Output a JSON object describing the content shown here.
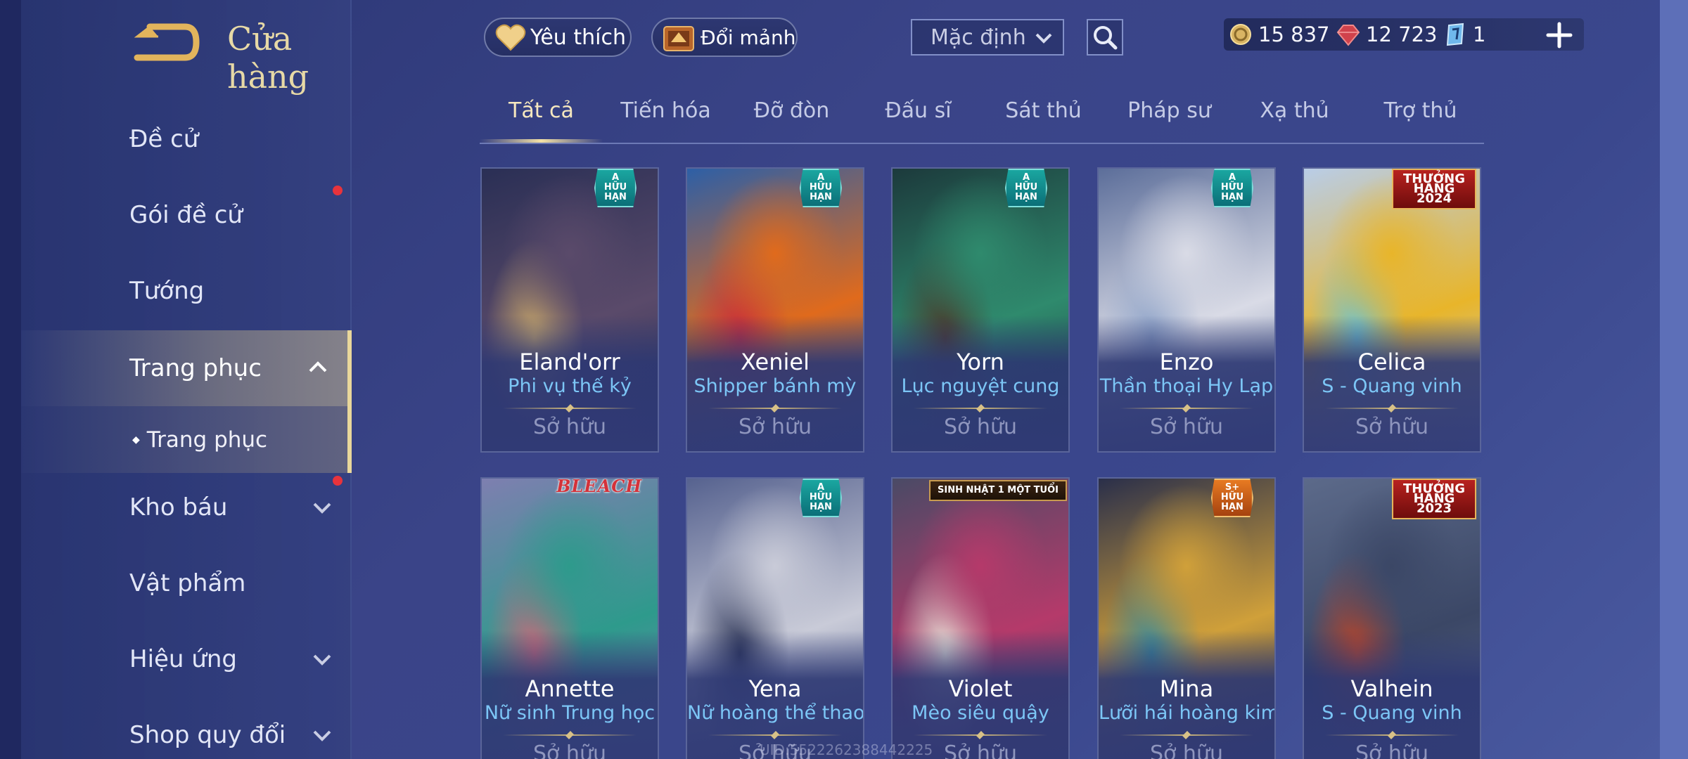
{
  "sidebar": {
    "title": "Cửa hàng",
    "items": [
      {
        "label": "Đề cử",
        "chevron": false,
        "red_dot": false
      },
      {
        "label": "Gói đề cử",
        "chevron": false,
        "red_dot": true
      },
      {
        "label": "Tướng",
        "chevron": false,
        "red_dot": false
      },
      {
        "label": "Trang phục",
        "chevron": "up",
        "red_dot": false,
        "active": true
      },
      {
        "label": "Kho báu",
        "chevron": "down",
        "red_dot": true
      },
      {
        "label": "Vật phẩm",
        "chevron": false,
        "red_dot": false
      },
      {
        "label": "Hiệu ứng",
        "chevron": "down",
        "red_dot": false
      },
      {
        "label": "Shop quy đổi",
        "chevron": "down",
        "red_dot": false
      }
    ],
    "sub_item": "Trang phục"
  },
  "topbar": {
    "favorite_label": "Yêu thích",
    "exchange_label": "Đổi mảnh",
    "sort_value": "Mặc định",
    "currencies": [
      {
        "icon": "gold-coin-icon",
        "value": "15 837"
      },
      {
        "icon": "ruby-gem-icon",
        "value": "12 723"
      },
      {
        "icon": "ticket-icon",
        "value": "1"
      }
    ]
  },
  "tabs": [
    "Tất cả",
    "Tiến hóa",
    "Đỡ đòn",
    "Đấu sĩ",
    "Sát thủ",
    "Pháp sư",
    "Xạ thủ",
    "Trợ thủ"
  ],
  "active_tab": 0,
  "cards": [
    {
      "hero": "Eland'orr",
      "skin": "Phi vụ thế kỷ",
      "status": "Sở hữu",
      "badge": "A HỮU HẠN",
      "badge_style": "teal",
      "colors": [
        "#2a2f55",
        "#5a4a6a",
        "#c7a66a"
      ]
    },
    {
      "hero": "Xeniel",
      "skin": "Shipper bánh mỳ",
      "status": "Sở hữu",
      "badge": "A HỮU HẠN",
      "badge_style": "teal",
      "colors": [
        "#2d5fa6",
        "#e06a1c",
        "#c92c3a"
      ]
    },
    {
      "hero": "Yorn",
      "skin": "Lục nguyệt cung",
      "status": "Sở hữu",
      "badge": "A HỮU HẠN",
      "badge_style": "teal",
      "colors": [
        "#1c3a3c",
        "#2f8a6d",
        "#4b3a2a"
      ]
    },
    {
      "hero": "Enzo",
      "skin": "Thần thoại Hy Lạp",
      "status": "Sở hữu",
      "badge": "A HỮU HẠN",
      "badge_style": "teal",
      "colors": [
        "#5c6e9a",
        "#d9dbe6",
        "#8ea3c8"
      ]
    },
    {
      "hero": "Celica",
      "skin": "S - Quang vinh",
      "status": "Sở hữu",
      "badge": "THƯỞNG HẠNG 2024",
      "badge_style": "red",
      "colors": [
        "#b9cde8",
        "#e8b52a",
        "#6fc3cf"
      ]
    },
    {
      "hero": "Annette",
      "skin": "Nữ sinh Trung học",
      "status": "Sở hữu",
      "badge": "BLEACH",
      "badge_style": "bleach",
      "colors": [
        "#7e7fb0",
        "#2e9a8c",
        "#c96a7a"
      ]
    },
    {
      "hero": "Yena",
      "skin": "Nữ hoàng thể thao",
      "status": "Sở hữu",
      "badge": "A HỮU HẠN",
      "badge_style": "teal",
      "colors": [
        "#56628f",
        "#c9cbd8",
        "#2c3456"
      ]
    },
    {
      "hero": "Violet",
      "skin": "Mèo siêu quậy",
      "status": "Sở hữu",
      "badge": "SINH NHẬT 1 MỘT TUỔI",
      "badge_style": "brown",
      "colors": [
        "#4a4a66",
        "#b53a6a",
        "#e8e2d8"
      ]
    },
    {
      "hero": "Mina",
      "skin": "Lưỡi hái hoàng kim",
      "status": "Sở hữu",
      "badge": "S+ HỮU HẠN",
      "badge_style": "orange",
      "colors": [
        "#2a2f4a",
        "#d0a03a",
        "#3a8a9a"
      ]
    },
    {
      "hero": "Valhein",
      "skin": "S - Quang vinh",
      "status": "Sở hữu",
      "badge": "THƯỞNG HẠNG 2023",
      "badge_style": "red",
      "colors": [
        "#5c6a8a",
        "#3b4766",
        "#b8452a"
      ]
    }
  ],
  "watermark": "UID:5522262388442225"
}
